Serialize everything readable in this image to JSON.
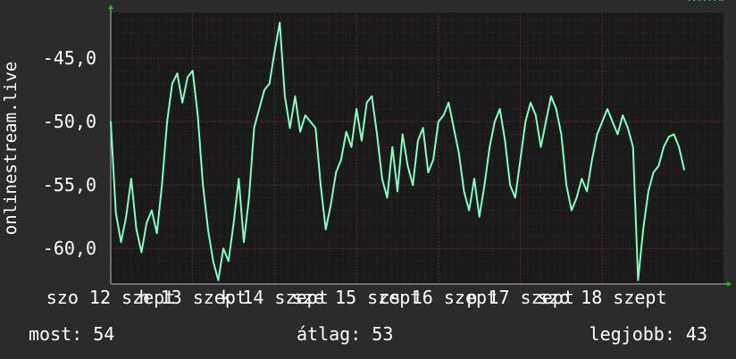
{
  "chart_data": {
    "type": "line",
    "ylabel": "onlinestream.live",
    "ylim": [
      -62.8,
      -41.4
    ],
    "y_ticks": [
      -60,
      -55,
      -50,
      -45
    ],
    "y_tick_labels": [
      "-60,0",
      "-55,0",
      "-50,0",
      "-45,0"
    ],
    "x_tick_labels": [
      "szo 12 szept",
      "h 13 szept",
      "k 14 szept",
      "sze 15 szept",
      "cs 16 szept",
      "p 17 szept",
      "szo 18 szept"
    ],
    "x_tick_days": [
      0,
      1,
      2,
      3,
      4,
      5,
      6
    ],
    "x_range_days": [
      0,
      7.48
    ],
    "grid": true,
    "series": [
      {
        "color": "#80ffc0",
        "x_days": [
          0,
          0.0625,
          0.125,
          0.1875,
          0.25,
          0.3125,
          0.375,
          0.4375,
          0.5,
          0.5625,
          0.625,
          0.6875,
          0.75,
          0.8125,
          0.875,
          0.9375,
          1,
          1.0625,
          1.125,
          1.1875,
          1.25,
          1.3125,
          1.375,
          1.4375,
          1.5,
          1.5625,
          1.625,
          1.6875,
          1.75,
          1.8125,
          1.875,
          1.9375,
          2,
          2.0625,
          2.125,
          2.1875,
          2.25,
          2.3125,
          2.375,
          2.4375,
          2.5,
          2.5625,
          2.625,
          2.6875,
          2.75,
          2.8125,
          2.875,
          2.9375,
          3,
          3.0625,
          3.125,
          3.1875,
          3.25,
          3.3125,
          3.375,
          3.4375,
          3.5,
          3.5625,
          3.625,
          3.6875,
          3.75,
          3.8125,
          3.875,
          3.9375,
          4,
          4.0625,
          4.125,
          4.1875,
          4.25,
          4.3125,
          4.375,
          4.4375,
          4.5,
          4.5625,
          4.625,
          4.6875,
          4.75,
          4.8125,
          4.875,
          4.9375,
          5,
          5.0625,
          5.125,
          5.1875,
          5.25,
          5.3125,
          5.375,
          5.4375,
          5.5,
          5.5625,
          5.625,
          5.6875,
          5.75,
          5.8125,
          5.875,
          5.9375,
          6,
          6.0625,
          6.125,
          6.1875,
          6.25,
          6.3125,
          6.375,
          6.4375,
          6.5,
          6.5625,
          6.625,
          6.6875,
          6.75,
          6.8125,
          6.875,
          6.9375,
          7,
          7.0625,
          7.125,
          7.1875,
          7.25,
          7.3125,
          7.375,
          7.4375,
          7.47
        ],
        "values": [
          -50.0,
          -57.2,
          -59.5,
          -57.5,
          -54.5,
          -58.5,
          -60.3,
          -58.0,
          -57.0,
          -58.8,
          -55.0,
          -50.0,
          -47.0,
          -46.2,
          -48.5,
          -46.5,
          -46.0,
          -49.5,
          -55.0,
          -58.5,
          -61.0,
          -62.5,
          -60.0,
          -61.0,
          -58.0,
          -54.5,
          -59.5,
          -56.0,
          -50.5,
          -49.0,
          -47.5,
          -47.0,
          -44.5,
          -42.2,
          -48.0,
          -50.5,
          -48.0,
          -50.8,
          -49.5,
          -50.0,
          -50.5,
          -55.0,
          -58.5,
          -56.5,
          -54.0,
          -53.0,
          -50.8,
          -52.0,
          -49.0,
          -51.5,
          -48.5,
          -48.0,
          -51.0,
          -54.5,
          -56.0,
          -52.0,
          -55.5,
          -51.0,
          -53.5,
          -55.0,
          -51.5,
          -50.5,
          -54.0,
          -53.0,
          -50.0,
          -49.5,
          -48.5,
          -50.5,
          -52.5,
          -55.5,
          -57.0,
          -54.5,
          -57.5,
          -55.0,
          -52.0,
          -50.0,
          -49.0,
          -51.5,
          -55.0,
          -56.0,
          -53.0,
          -50.0,
          -48.5,
          -49.5,
          -52.0,
          -50.0,
          -48.0,
          -49.0,
          -51.0,
          -55.0,
          -57.0,
          -56.0,
          -54.5,
          -55.5,
          -53.0,
          -51.0,
          -50.0,
          -49.0,
          -50.0,
          -51.0,
          -49.5,
          -50.5,
          -52.0,
          -62.5,
          -58.5,
          -55.5,
          -54.0,
          -53.5,
          -52.0,
          -51.2,
          -51.0,
          -52.0,
          -53.8
        ]
      }
    ]
  },
  "stats": {
    "now": "most: 54",
    "avg": "átlag: 53",
    "best": "legjobb: 43"
  },
  "colors": {
    "background": "#2b2b2b",
    "plot_background": "#1a1a1a",
    "grid": "#5a2a2a",
    "line": "#80ffc0",
    "text": "#ffffff",
    "arrow": "#00d000"
  }
}
